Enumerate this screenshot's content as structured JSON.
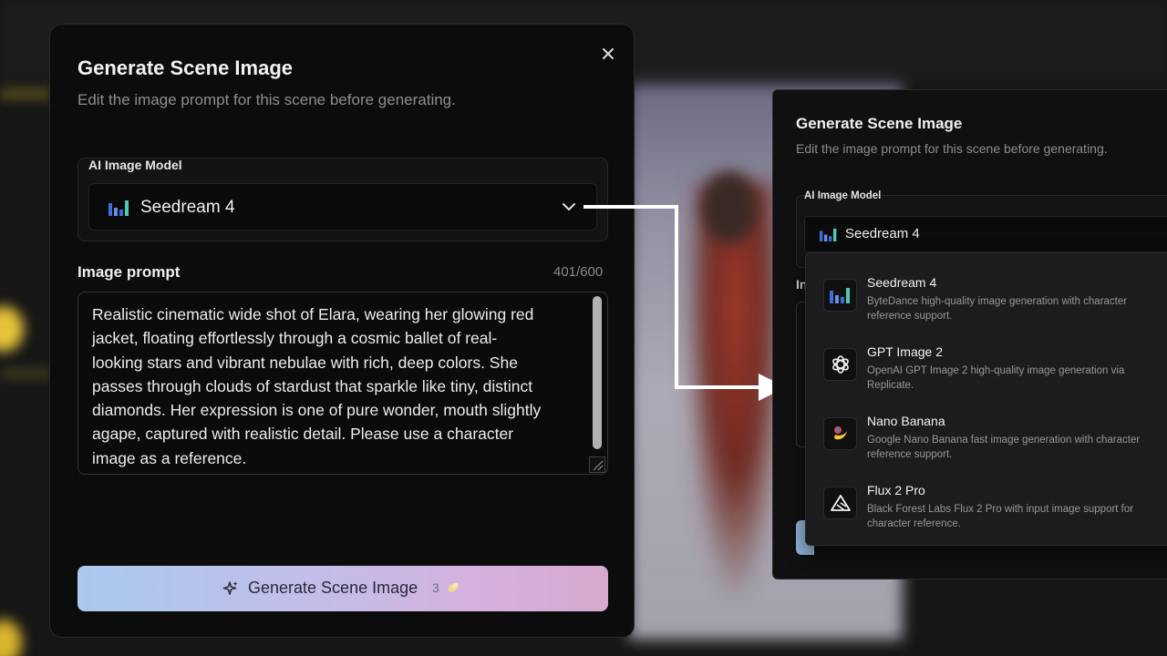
{
  "modal": {
    "title": "Generate Scene Image",
    "subtitle": "Edit the image prompt for this scene before generating.",
    "model_label": "AI Image Model",
    "selected_model": "Seedream 4",
    "prompt_label": "Image prompt",
    "prompt_count": "401/600",
    "prompt_lines": [
      "Realistic cinematic wide shot of Elara, wearing her glowing red",
      "jacket, floating effortlessly through a cosmic ballet of real-",
      "looking stars and vibrant nebulae with rich, deep colors. She",
      "passes through clouds of stardust that sparkle like tiny, distinct",
      "diamonds. Her expression is one of pure wonder, mouth slightly",
      "agape, captured with realistic detail. Please use a character",
      "image as a reference."
    ],
    "generate_label": "Generate Scene Image",
    "credits": "3"
  },
  "zoom": {
    "title": "Generate Scene Image",
    "subtitle": "Edit the image prompt for this scene before generating.",
    "model_label": "AI Image Model",
    "selected_model": "Seedream 4",
    "ghost_label": "In",
    "options": [
      {
        "name": "Seedream 4",
        "desc1": "ByteDance high-quality image generation with character",
        "desc2": "reference support.",
        "icon": "seedream-icon"
      },
      {
        "name": "GPT Image 2",
        "desc1": "OpenAI GPT Image 2 high-quality image generation via",
        "desc2": "Replicate.",
        "icon": "openai-icon"
      },
      {
        "name": "Nano Banana",
        "desc1": "Google Nano Banana fast image generation with character",
        "desc2": "reference support.",
        "icon": "banana-icon"
      },
      {
        "name": "Flux 2 Pro",
        "desc1": "Black Forest Labs Flux 2 Pro with input image support for",
        "desc2": "character reference.",
        "icon": "flux-icon"
      }
    ]
  },
  "colors": {
    "modal_bg": "#0c0c0d",
    "button_gradient_start": "#a9c9ee",
    "button_gradient_end": "#d7a9cd"
  }
}
